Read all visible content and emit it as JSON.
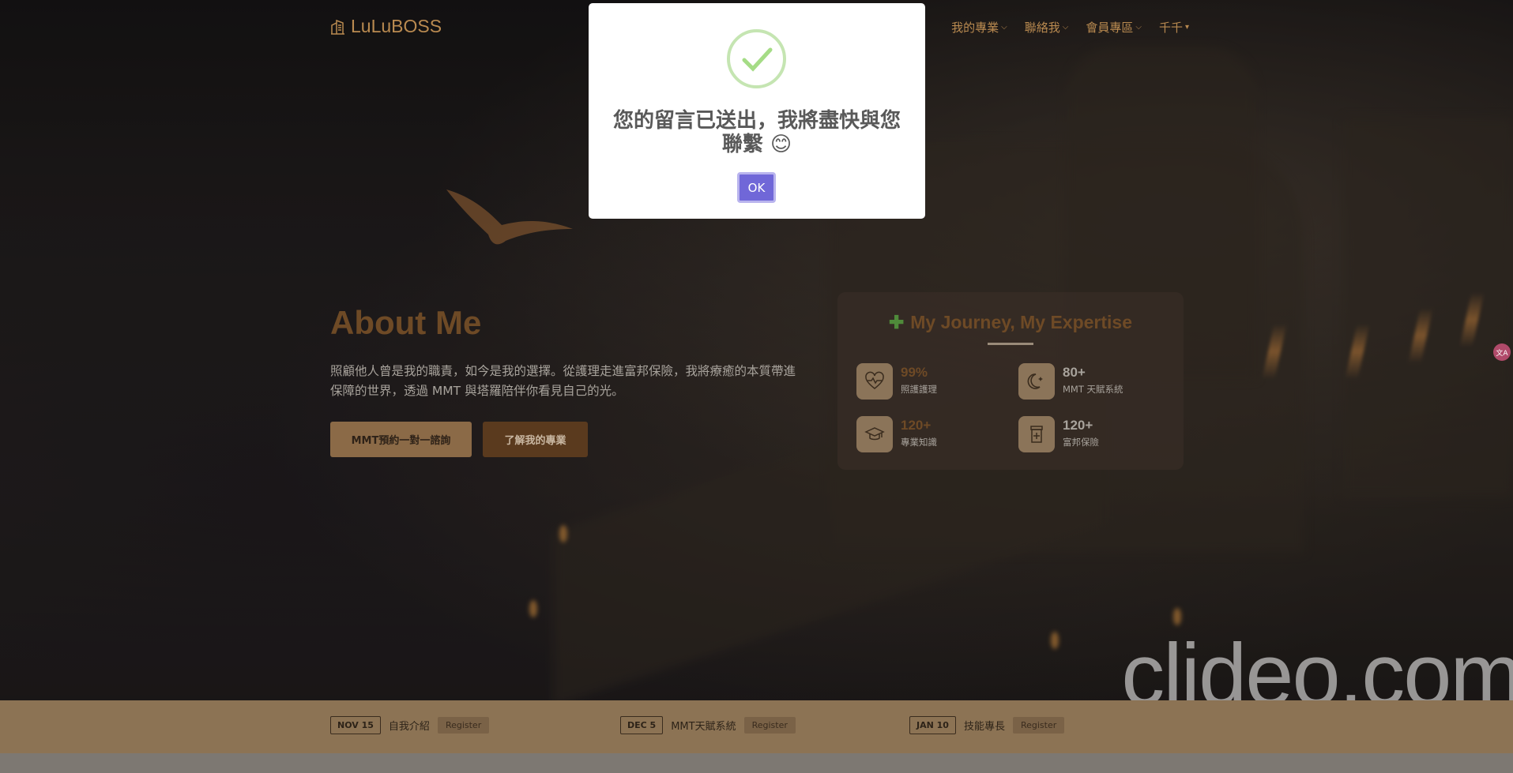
{
  "navbar": {
    "brand": "LuLuBOSS",
    "items": [
      {
        "label": "我的專業"
      },
      {
        "label": "聯絡我"
      },
      {
        "label": "會員專區"
      },
      {
        "label": "千千"
      }
    ]
  },
  "hero": {
    "title": "About Me",
    "text": "照顧他人曾是我的職責，如今是我的選擇。從護理走進富邦保險，我將療癒的本質帶進保障的世界，透過 MMT 與塔羅陪伴你看見自己的光。",
    "primary_button": "MMT預約一對一諮詢",
    "secondary_button": "了解我的專業"
  },
  "expertise": {
    "title": "My Journey, My Expertise",
    "stats": [
      {
        "value": "99%",
        "label": "照護護理",
        "icon": "heart-pulse-icon",
        "color": "#6e4a26"
      },
      {
        "value": "80+",
        "label": "MMT 天賦系統",
        "icon": "moon-icon",
        "color": "#a8a39c"
      },
      {
        "value": "120+",
        "label": "專業知識",
        "icon": "graduation-cap-icon",
        "color": "#6e4a26"
      },
      {
        "value": "120+",
        "label": "富邦保險",
        "icon": "medicine-bottle-icon",
        "color": "#a8a39c"
      }
    ]
  },
  "events": [
    {
      "date": "NOV 15",
      "name": "自我介紹",
      "register": "Register"
    },
    {
      "date": "DEC 5",
      "name": "MMT天賦系統",
      "register": "Register"
    },
    {
      "date": "JAN 10",
      "name": "技能專長",
      "register": "Register"
    }
  ],
  "modal": {
    "title": "您的留言已送出，我將盡快與您聯繫 😊",
    "ok_label": "OK"
  },
  "watermark": "clideo.com",
  "colors": {
    "accent": "#b98a50",
    "title_brown": "#6e4a26",
    "modal_button": "#7067d8",
    "success_ring": "#c5e5b2",
    "success_check": "#a5dc86"
  }
}
